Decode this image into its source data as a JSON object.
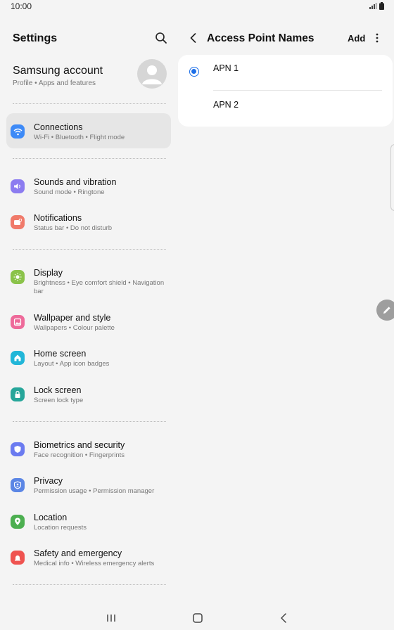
{
  "status": {
    "time": "10:00"
  },
  "left": {
    "title": "Settings",
    "account": {
      "name": "Samsung account",
      "sub": "Profile  •  Apps and features"
    },
    "items": [
      {
        "title": "Connections",
        "sub": "Wi-Fi  •  Bluetooth  •  Flight mode",
        "color": "#3d8af7"
      },
      {
        "title": "Sounds and vibration",
        "sub": "Sound mode  •  Ringtone",
        "color": "#8c7cf0"
      },
      {
        "title": "Notifications",
        "sub": "Status bar  •  Do not disturb",
        "color": "#f07a6a"
      },
      {
        "title": "Display",
        "sub": "Brightness  •  Eye comfort shield  •  Navigation bar",
        "color": "#8bc34a"
      },
      {
        "title": "Wallpaper and style",
        "sub": "Wallpapers  •  Colour palette",
        "color": "#ee6a9a"
      },
      {
        "title": "Home screen",
        "sub": "Layout  •  App icon badges",
        "color": "#21b6d8"
      },
      {
        "title": "Lock screen",
        "sub": "Screen lock type",
        "color": "#26a69a"
      },
      {
        "title": "Biometrics and security",
        "sub": "Face recognition  •  Fingerprints",
        "color": "#6b7bf0"
      },
      {
        "title": "Privacy",
        "sub": "Permission usage  •  Permission manager",
        "color": "#5b86e5"
      },
      {
        "title": "Location",
        "sub": "Location requests",
        "color": "#4caf50"
      },
      {
        "title": "Safety and emergency",
        "sub": "Medical info  •  Wireless emergency alerts",
        "color": "#ef5350"
      }
    ]
  },
  "right": {
    "title": "Access Point Names",
    "add": "Add",
    "apns": [
      {
        "label": "APN 1",
        "selected": true
      },
      {
        "label": "APN 2",
        "selected": false
      }
    ]
  }
}
